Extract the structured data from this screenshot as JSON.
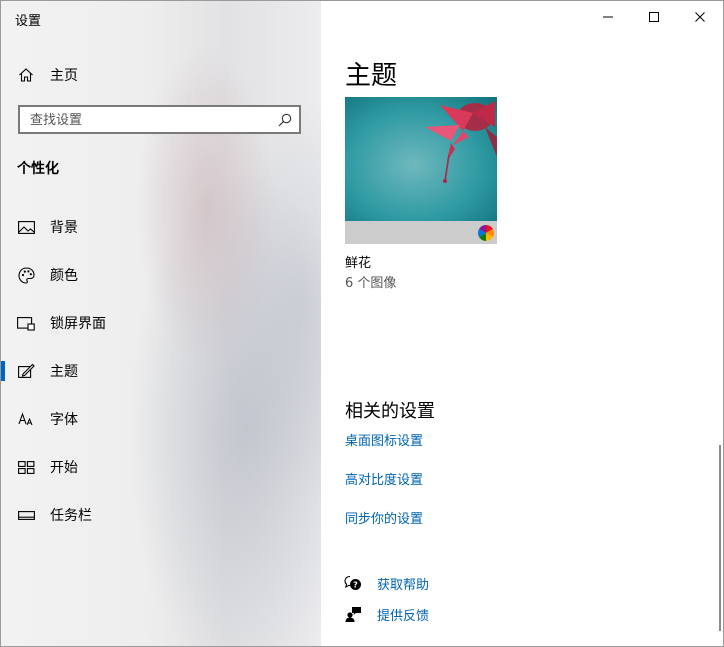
{
  "window": {
    "title": "设置"
  },
  "sidebar": {
    "home_label": "主页",
    "search_placeholder": "查找设置",
    "section_title": "个性化",
    "items": [
      {
        "label": "背景",
        "icon": "picture-icon"
      },
      {
        "label": "颜色",
        "icon": "palette-icon"
      },
      {
        "label": "锁屏界面",
        "icon": "lock-screen-icon"
      },
      {
        "label": "主题",
        "icon": "theme-pen-icon",
        "selected": true
      },
      {
        "label": "字体",
        "icon": "font-icon"
      },
      {
        "label": "开始",
        "icon": "start-grid-icon"
      },
      {
        "label": "任务栏",
        "icon": "taskbar-icon"
      }
    ]
  },
  "main": {
    "title": "主题",
    "theme": {
      "name": "鲜花",
      "count": "6 个图像"
    },
    "related_title": "相关的设置",
    "related_links": [
      "桌面图标设置",
      "高对比度设置",
      "同步你的设置"
    ],
    "help": {
      "get_help": "获取帮助",
      "feedback": "提供反馈"
    }
  },
  "colors": {
    "accent": "#0067c0",
    "link": "#0063b1",
    "theme_bar": "#cccccc"
  }
}
